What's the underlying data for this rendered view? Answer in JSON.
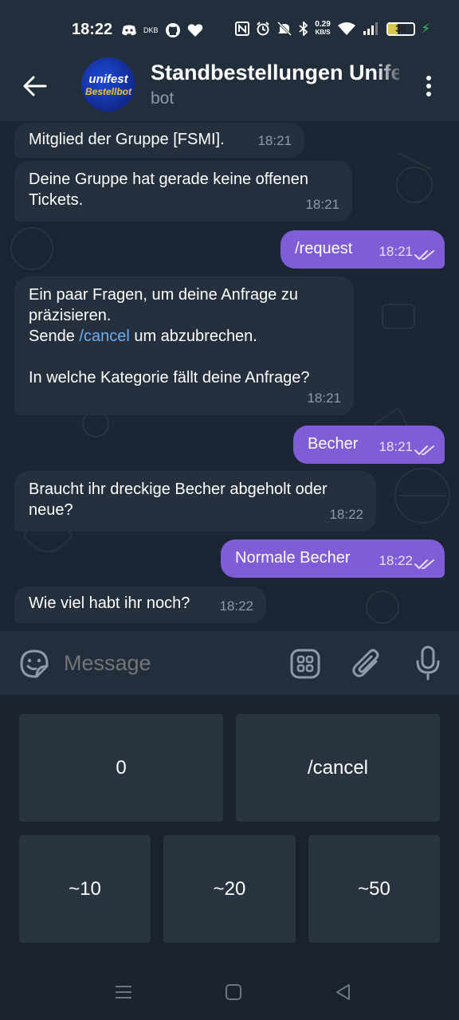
{
  "status_bar": {
    "time": "18:22",
    "left_text": "DKB",
    "speed_value": "0.29",
    "speed_unit": "KB/S",
    "battery": "38",
    "battery_level_percent": 38
  },
  "header": {
    "title": "Standbestellungen Unifest",
    "subtitle": "bot",
    "avatar_line1": "unifest",
    "avatar_line2": "Bestellbot"
  },
  "messages": [
    {
      "dir": "in",
      "text": "Mitglied der Gruppe [FSMI].",
      "time": "18:21"
    },
    {
      "dir": "in",
      "text": "Deine Gruppe hat gerade keine offenen Tickets.",
      "time": "18:21"
    },
    {
      "dir": "out",
      "text": "/request",
      "time": "18:21"
    },
    {
      "dir": "in",
      "line1": "Ein paar Fragen, um deine Anfrage zu präzisieren.",
      "line2_pre": "Sende ",
      "line2_cmd": "/cancel",
      "line2_post": " um abzubrechen.",
      "line3": "In welche Kategorie fällt deine Anfrage?",
      "time": "18:21"
    },
    {
      "dir": "out",
      "text": "Becher",
      "time": "18:21"
    },
    {
      "dir": "in",
      "text": "Braucht ihr dreckige Becher abgeholt oder neue?",
      "time": "18:22"
    },
    {
      "dir": "out",
      "text": "Normale Becher",
      "time": "18:22"
    },
    {
      "dir": "in",
      "text": "Wie viel habt ihr noch?",
      "time": "18:22"
    }
  ],
  "input": {
    "placeholder": "Message"
  },
  "keyboard": {
    "row1": [
      "0",
      "/cancel"
    ],
    "row2": [
      "~10",
      "~20",
      "~50"
    ]
  },
  "colors": {
    "outgoing_bubble": "#7f5dd6",
    "incoming_bubble": "#262f3d",
    "link": "#6aaff0"
  }
}
